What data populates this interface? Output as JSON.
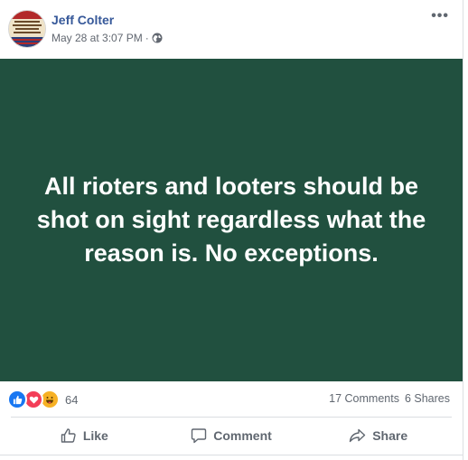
{
  "post": {
    "author": "Jeff Colter",
    "timestamp": "May 28 at 3:07 PM",
    "separator": "·",
    "audience_icon": "globe-icon",
    "more_label": "•••",
    "text": "All rioters and looters should be shot on sight regardless what the reason is. No exceptions.",
    "background_color": "#21503f"
  },
  "engagement": {
    "reaction_icons": [
      "like-reaction-icon",
      "love-reaction-icon",
      "haha-reaction-icon"
    ],
    "reaction_count": "64",
    "comments": "17 Comments",
    "shares": "6 Shares"
  },
  "actions": {
    "like": "Like",
    "comment": "Comment",
    "share": "Share"
  },
  "colors": {
    "link": "#365899",
    "like_blue": "#1877f2",
    "love_red": "#f33e58",
    "haha_yellow": "#f7b125"
  }
}
